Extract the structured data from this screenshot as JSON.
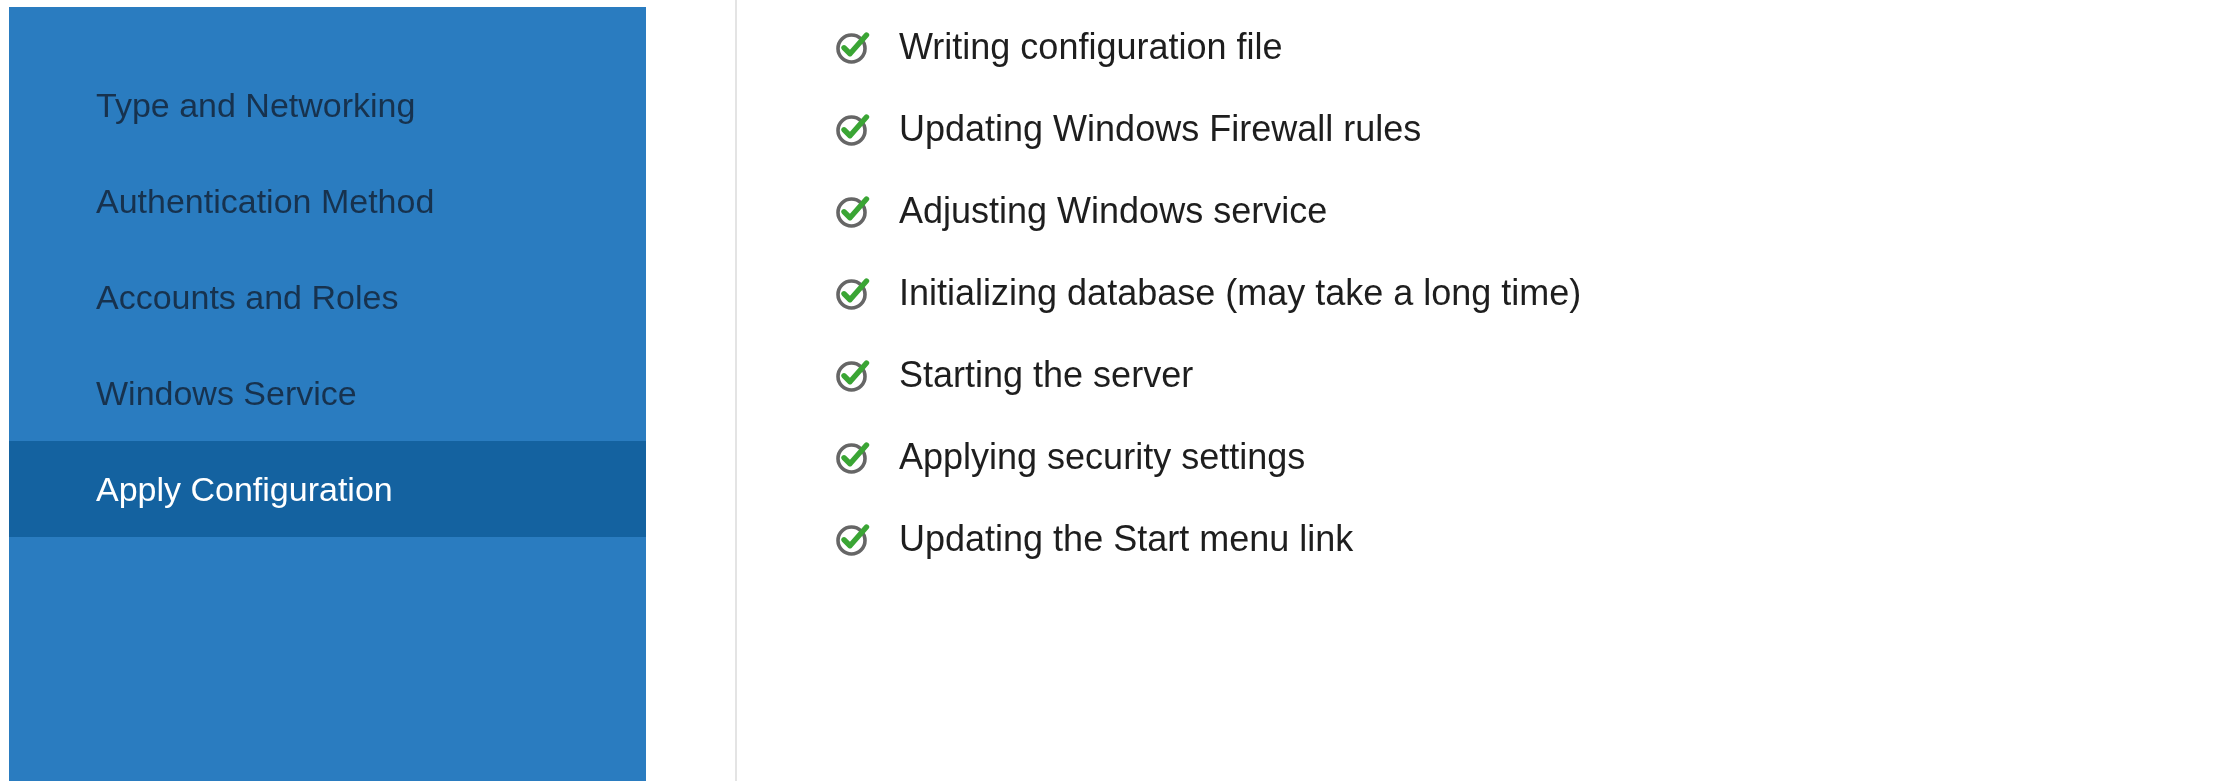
{
  "sidebar": {
    "items": [
      {
        "label": "Type and Networking",
        "selected": false
      },
      {
        "label": "Authentication Method",
        "selected": false
      },
      {
        "label": "Accounts and Roles",
        "selected": false
      },
      {
        "label": "Windows Service",
        "selected": false
      },
      {
        "label": "Apply Configuration",
        "selected": true
      }
    ]
  },
  "steps": [
    {
      "label": "Writing configuration file",
      "done": true
    },
    {
      "label": "Updating Windows Firewall rules",
      "done": true
    },
    {
      "label": "Adjusting Windows service",
      "done": true
    },
    {
      "label": "Initializing database (may take a long time)",
      "done": true
    },
    {
      "label": "Starting the server",
      "done": true
    },
    {
      "label": "Applying security settings",
      "done": true
    },
    {
      "label": "Updating the Start menu link",
      "done": true
    }
  ]
}
